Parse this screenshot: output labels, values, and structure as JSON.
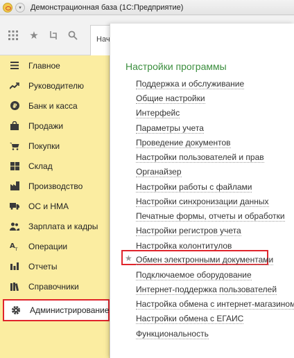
{
  "window": {
    "title": "Демонстрационная база (1С:Предприятие)"
  },
  "toolbar": {
    "start_tab": "Нача"
  },
  "sidebar": {
    "items": [
      {
        "label": "Главное",
        "icon": "menu-lines-icon"
      },
      {
        "label": "Руководителю",
        "icon": "trend-icon"
      },
      {
        "label": "Банк и касса",
        "icon": "ruble-coin-icon"
      },
      {
        "label": "Продажи",
        "icon": "shopping-bag-icon"
      },
      {
        "label": "Покупки",
        "icon": "cart-icon"
      },
      {
        "label": "Склад",
        "icon": "warehouse-icon"
      },
      {
        "label": "Производство",
        "icon": "factory-icon"
      },
      {
        "label": "ОС и НМА",
        "icon": "truck-icon"
      },
      {
        "label": "Зарплата и кадры",
        "icon": "people-icon"
      },
      {
        "label": "Операции",
        "icon": "operations-icon"
      },
      {
        "label": "Отчеты",
        "icon": "bar-chart-icon"
      },
      {
        "label": "Справочники",
        "icon": "books-icon"
      },
      {
        "label": "Администрирование",
        "icon": "gear-icon",
        "active": true
      }
    ]
  },
  "panel": {
    "title": "Настройки программы",
    "links": [
      "Поддержка и обслуживание",
      "Общие настройки",
      "Интерфейс",
      "Параметры учета",
      "Проведение документов",
      "Настройки пользователей и прав",
      "Органайзер",
      "Настройки работы с файлами",
      "Настройки синхронизации данных",
      "Печатные формы, отчеты и обработки",
      "Настройки регистров учета",
      "Настройка колонтитулов",
      "Обмен электронными документами",
      "Подключаемое оборудование",
      "Интернет-поддержка пользователей",
      "Настройка обмена с интернет-магазином",
      "Настройки обмена с ЕГАИС",
      "Функциональность"
    ],
    "favorite_link_index": 12
  },
  "colors": {
    "sidebar_bg": "#fbeda1",
    "highlight_red": "#e0242b",
    "title_green": "#3b8e3e"
  }
}
